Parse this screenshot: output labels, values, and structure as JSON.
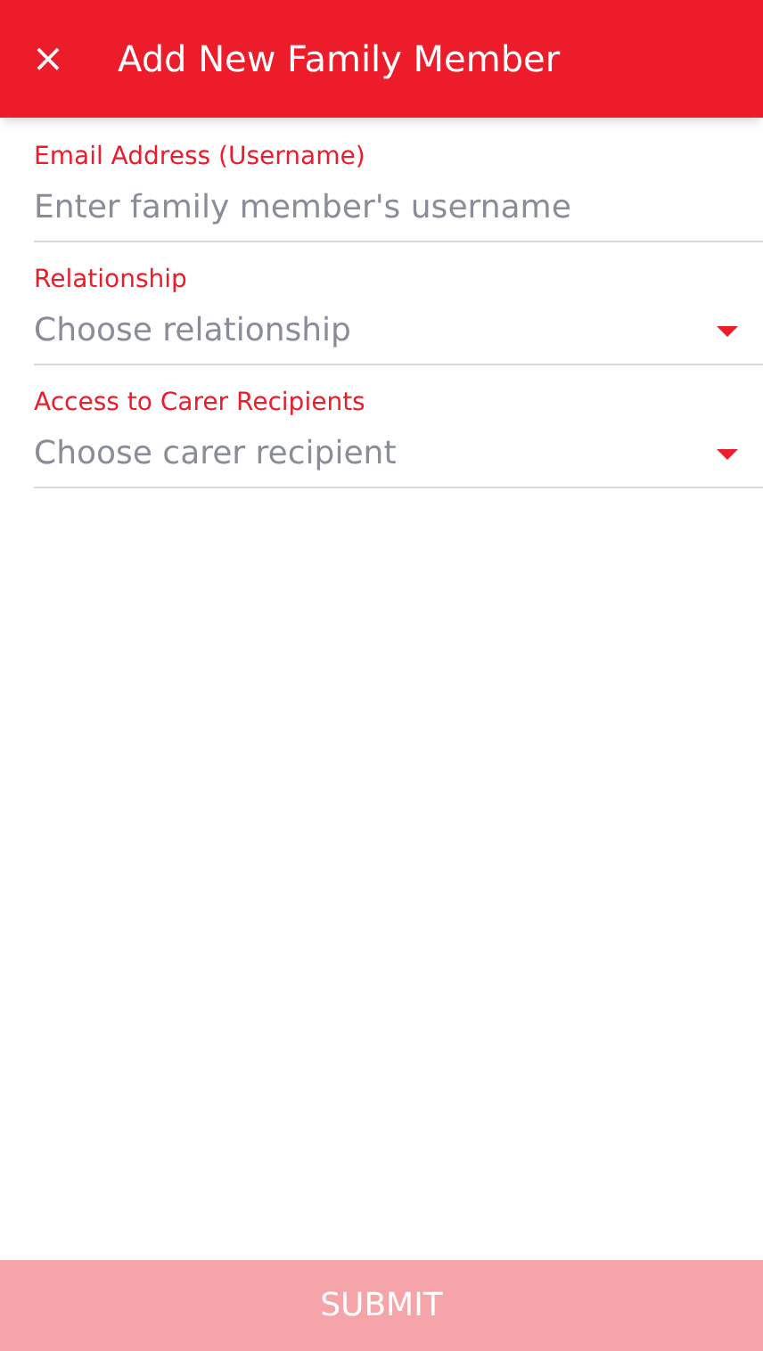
{
  "app_bar": {
    "close_icon": "×",
    "title": "Add New Family Member"
  },
  "fields": [
    {
      "kind": "text",
      "label": "Email Address (Username)",
      "placeholder": "Enter family member's username"
    },
    {
      "kind": "select",
      "label": "Relationship",
      "placeholder": "Choose relationship"
    },
    {
      "kind": "select",
      "label": "Access to Carer Recipients",
      "placeholder": "Choose carer recipient"
    }
  ],
  "submit": {
    "label": "SUBMIT",
    "disabled": true
  }
}
